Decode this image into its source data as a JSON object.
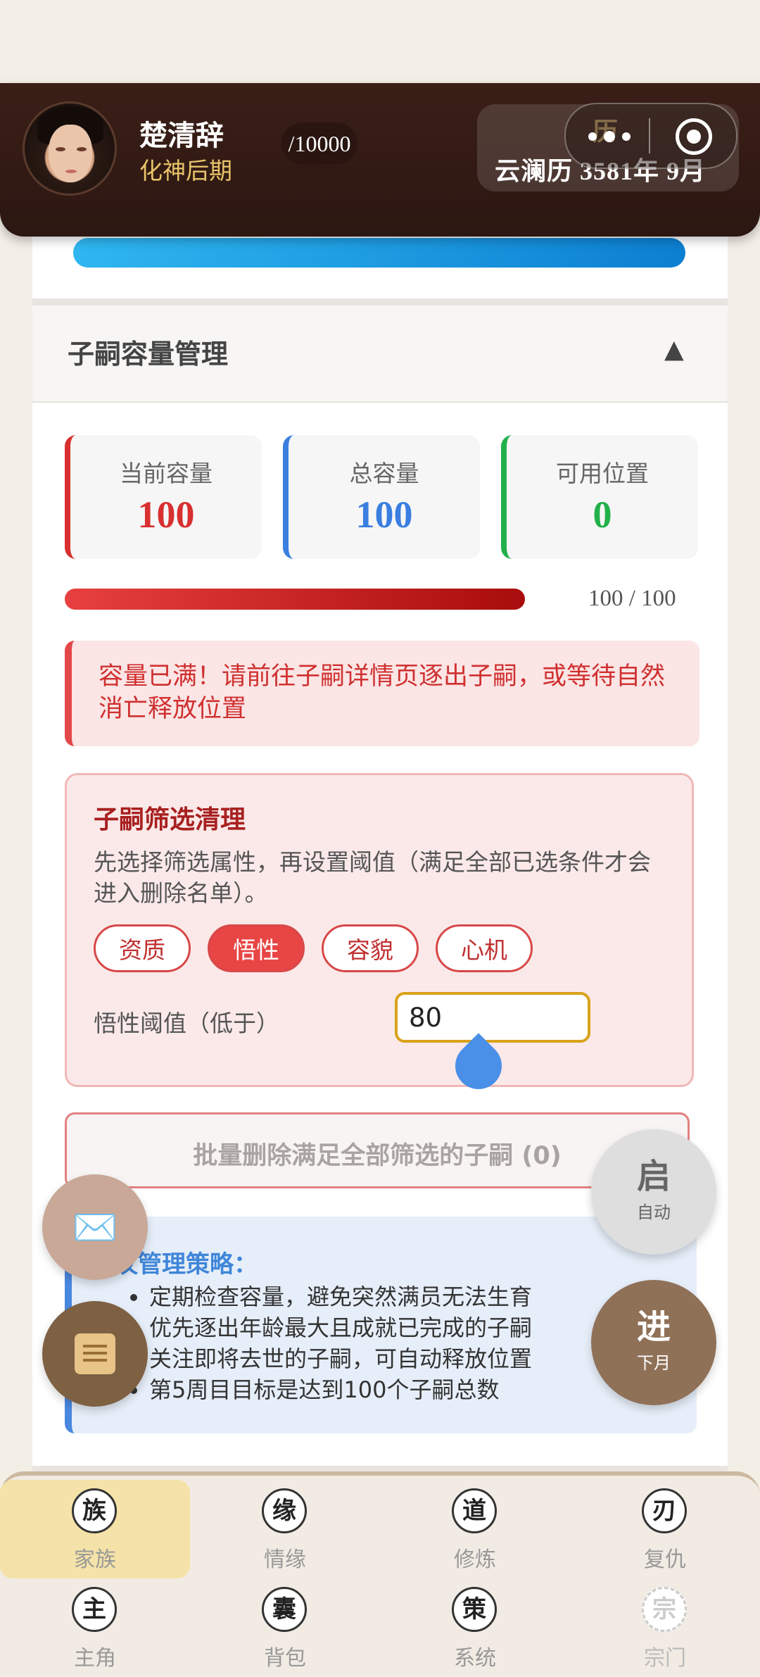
{
  "header": {
    "player_name": "楚清辞",
    "realm": "化神后期",
    "exp_text": "/10000",
    "calendar": "云澜历 3581年 9月",
    "overlay_char": "历"
  },
  "capacity": {
    "section_title": "子嗣容量管理",
    "collapse_icon": "▲",
    "stats": [
      {
        "label": "当前容量",
        "value": "100",
        "color": "#d83030"
      },
      {
        "label": "总容量",
        "value": "100",
        "color": "#3a7ee0"
      },
      {
        "label": "可用位置",
        "value": "0",
        "color": "#22b04a"
      }
    ],
    "bar_fraction": 1.0,
    "bar_text": "100 / 100",
    "warning": "容量已满！请前往子嗣详情页逐出子嗣，或等待自然消亡释放位置"
  },
  "filter": {
    "title": "子嗣筛选清理",
    "description": "先选择筛选属性，再设置阈值（满足全部已选条件才会进入删除名单）。",
    "chips": [
      {
        "label": "资质",
        "active": false
      },
      {
        "label": "悟性",
        "active": true
      },
      {
        "label": "容貌",
        "active": false
      },
      {
        "label": "心机",
        "active": false
      }
    ],
    "threshold_label": "悟性阈值（低于）",
    "threshold_value": "80"
  },
  "bulk_delete_label": "批量删除满足全部筛选的子嗣 (0)",
  "tips": {
    "title": "议管理策略：",
    "items": [
      "定期检查容量，避免突然满员无法生育",
      "优先逐出年龄最大且成就已完成的子嗣",
      "关注即将去世的子嗣，可自动释放位置",
      "第5周目目标是达到100个子嗣总数"
    ]
  },
  "fabs": {
    "auto": {
      "big": "启",
      "small": "自动"
    },
    "next": {
      "big": "进",
      "small": "下月"
    },
    "mail_icon": "envelope-icon",
    "scroll_icon": "scroll-icon"
  },
  "nav": {
    "items": [
      {
        "icon": "族",
        "label": "家族"
      },
      {
        "icon": "缘",
        "label": "情缘"
      },
      {
        "icon": "道",
        "label": "修炼"
      },
      {
        "icon": "刃",
        "label": "复仇"
      },
      {
        "icon": "主",
        "label": "主角"
      },
      {
        "icon": "囊",
        "label": "背包"
      },
      {
        "icon": "策",
        "label": "系统"
      },
      {
        "icon": "宗",
        "label": "宗门"
      }
    ]
  }
}
